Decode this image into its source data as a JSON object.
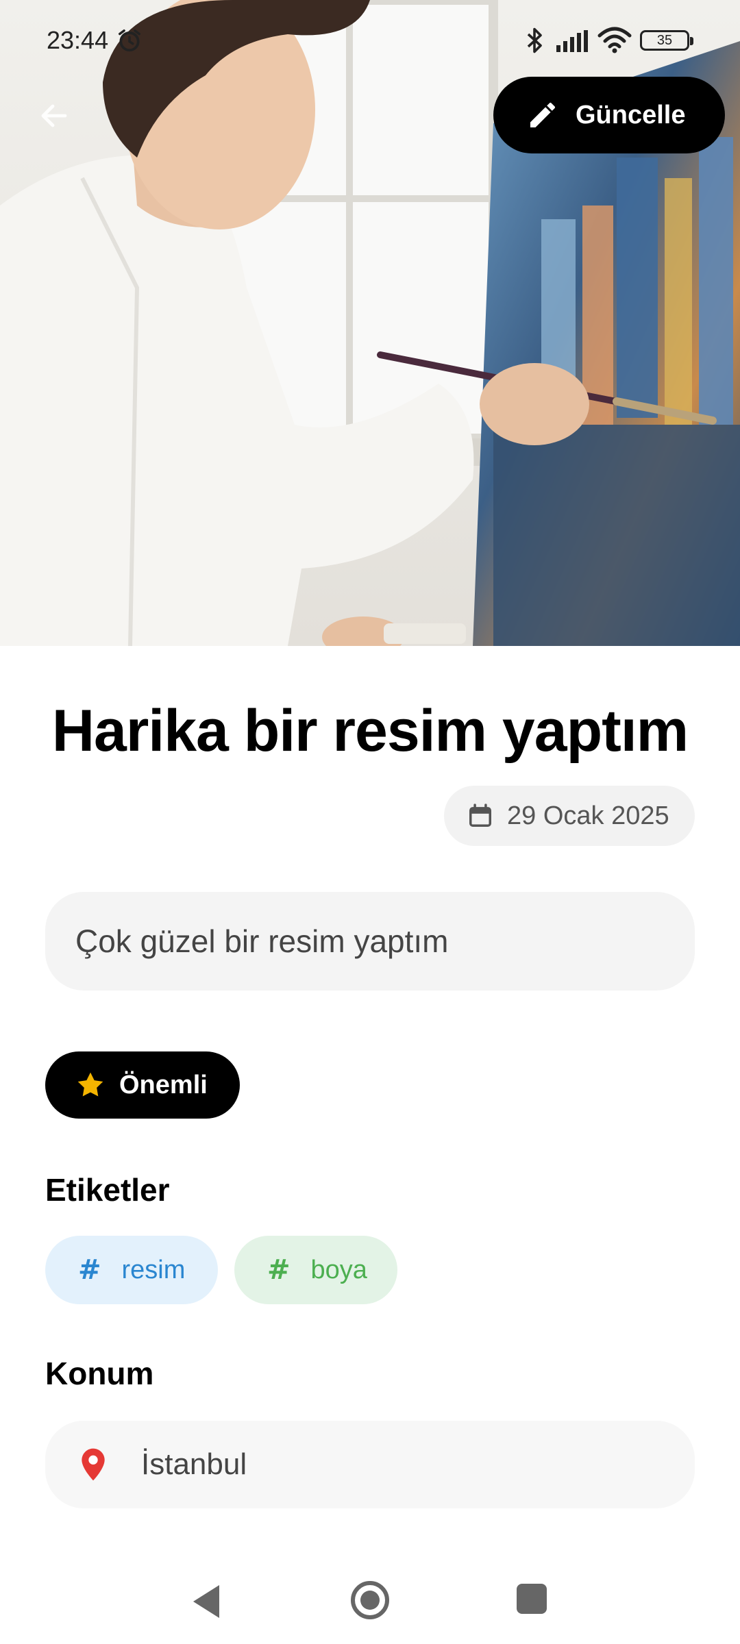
{
  "status_bar": {
    "time": "23:44",
    "battery_level": "35",
    "icons": [
      "alarm-icon",
      "bluetooth-icon",
      "signal-icon",
      "wifi-icon",
      "battery-icon"
    ]
  },
  "header": {
    "back_icon": "arrow-left-icon",
    "update_label": "Güncelle",
    "update_icon": "pencil-icon"
  },
  "note": {
    "title": "Harika bir resim yaptım",
    "date": "29 Ocak 2025",
    "description": "Çok güzel bir resim yaptım",
    "important_label": "Önemli"
  },
  "tags_section": {
    "title": "Etiketler",
    "tags": [
      {
        "label": "resim",
        "color": "#2a86d0",
        "bg": "#e3f1fc"
      },
      {
        "label": "boya",
        "color": "#4caf50",
        "bg": "#e3f3e6"
      }
    ]
  },
  "location_section": {
    "title": "Konum",
    "location": "İstanbul",
    "pin_color": "#e53935"
  },
  "colors": {
    "primary": "#000000",
    "star": "#f4b400",
    "chip_bg": "#f2f2f2"
  },
  "nav_bar": {
    "icons": [
      "nav-back-icon",
      "nav-home-icon",
      "nav-recent-icon"
    ]
  }
}
